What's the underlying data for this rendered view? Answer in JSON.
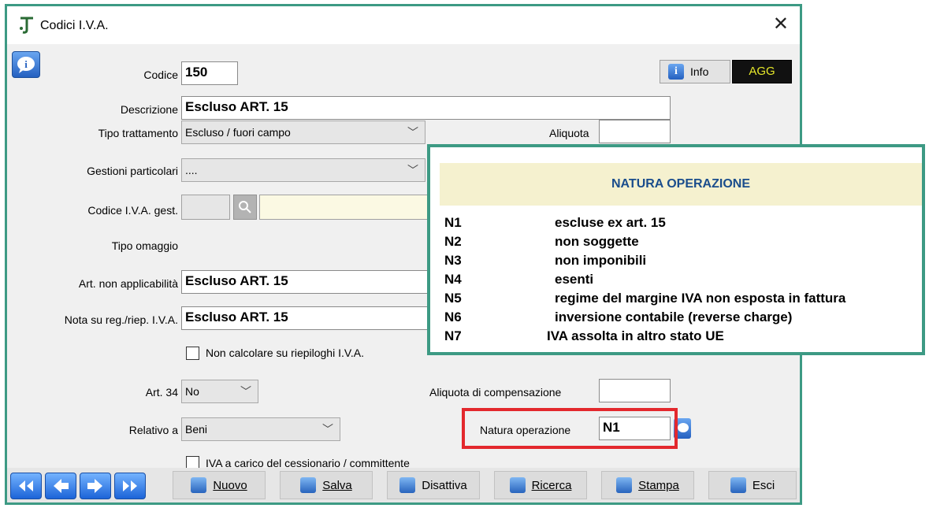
{
  "window": {
    "title": "Codici I.V.A."
  },
  "header": {
    "info_label": "Info",
    "agg_label": "AGG"
  },
  "form": {
    "codice_label": "Codice",
    "codice_value": "150",
    "descrizione_label": "Descrizione",
    "descrizione_value": "Escluso  ART. 15",
    "tipo_trattamento_label": "Tipo trattamento",
    "tipo_trattamento_value": "Escluso / fuori campo",
    "aliquota_label": "Aliquota",
    "aliquota_value": "",
    "gestioni_label": "Gestioni particolari",
    "gestioni_value": "....",
    "codice_iva_gest_label": "Codice I.V.A. gest.",
    "tipo_omaggio_label": "Tipo omaggio",
    "art_non_app_label": "Art. non applicabilità",
    "art_non_app_value": "Escluso  ART. 15",
    "nota_label": "Nota su reg./riep. I.V.A.",
    "nota_value": "Escluso  ART. 15",
    "non_calcolare_label": "Non calcolare su riepiloghi I.V.A.",
    "art34_label": "Art. 34",
    "art34_value": "No",
    "aliquota_comp_label": "Aliquota di compensazione",
    "aliquota_comp_value": "",
    "relativo_label": "Relativo a",
    "relativo_value": "Beni",
    "natura_label": "Natura operazione",
    "natura_value": "N1",
    "iva_carico_label": "IVA a carico del cessionario / committente"
  },
  "toolbar": {
    "nuovo": "Nuovo",
    "salva": "Salva",
    "disattiva": "Disattiva",
    "ricerca": "Ricerca",
    "stampa": "Stampa",
    "esci": "Esci"
  },
  "natura_popup": {
    "title": "NATURA OPERAZIONE",
    "rows": [
      {
        "code": "N1",
        "desc": "escluse ex art. 15"
      },
      {
        "code": "N2",
        "desc": "non soggette"
      },
      {
        "code": "N3",
        "desc": "non imponibili"
      },
      {
        "code": "N4",
        "desc": "esenti"
      },
      {
        "code": "N5",
        "desc": "regime del margine IVA non esposta in fattura"
      },
      {
        "code": "N6",
        "desc": "inversione contabile (reverse charge)"
      },
      {
        "code": "N7",
        "desc": "IVA assolta in altro stato UE"
      }
    ]
  },
  "colors": {
    "frame": "#3d9a84",
    "highlight": "#e3282d",
    "popup_header_bg": "#f5f1cf",
    "popup_header_text": "#1a4d8c"
  }
}
